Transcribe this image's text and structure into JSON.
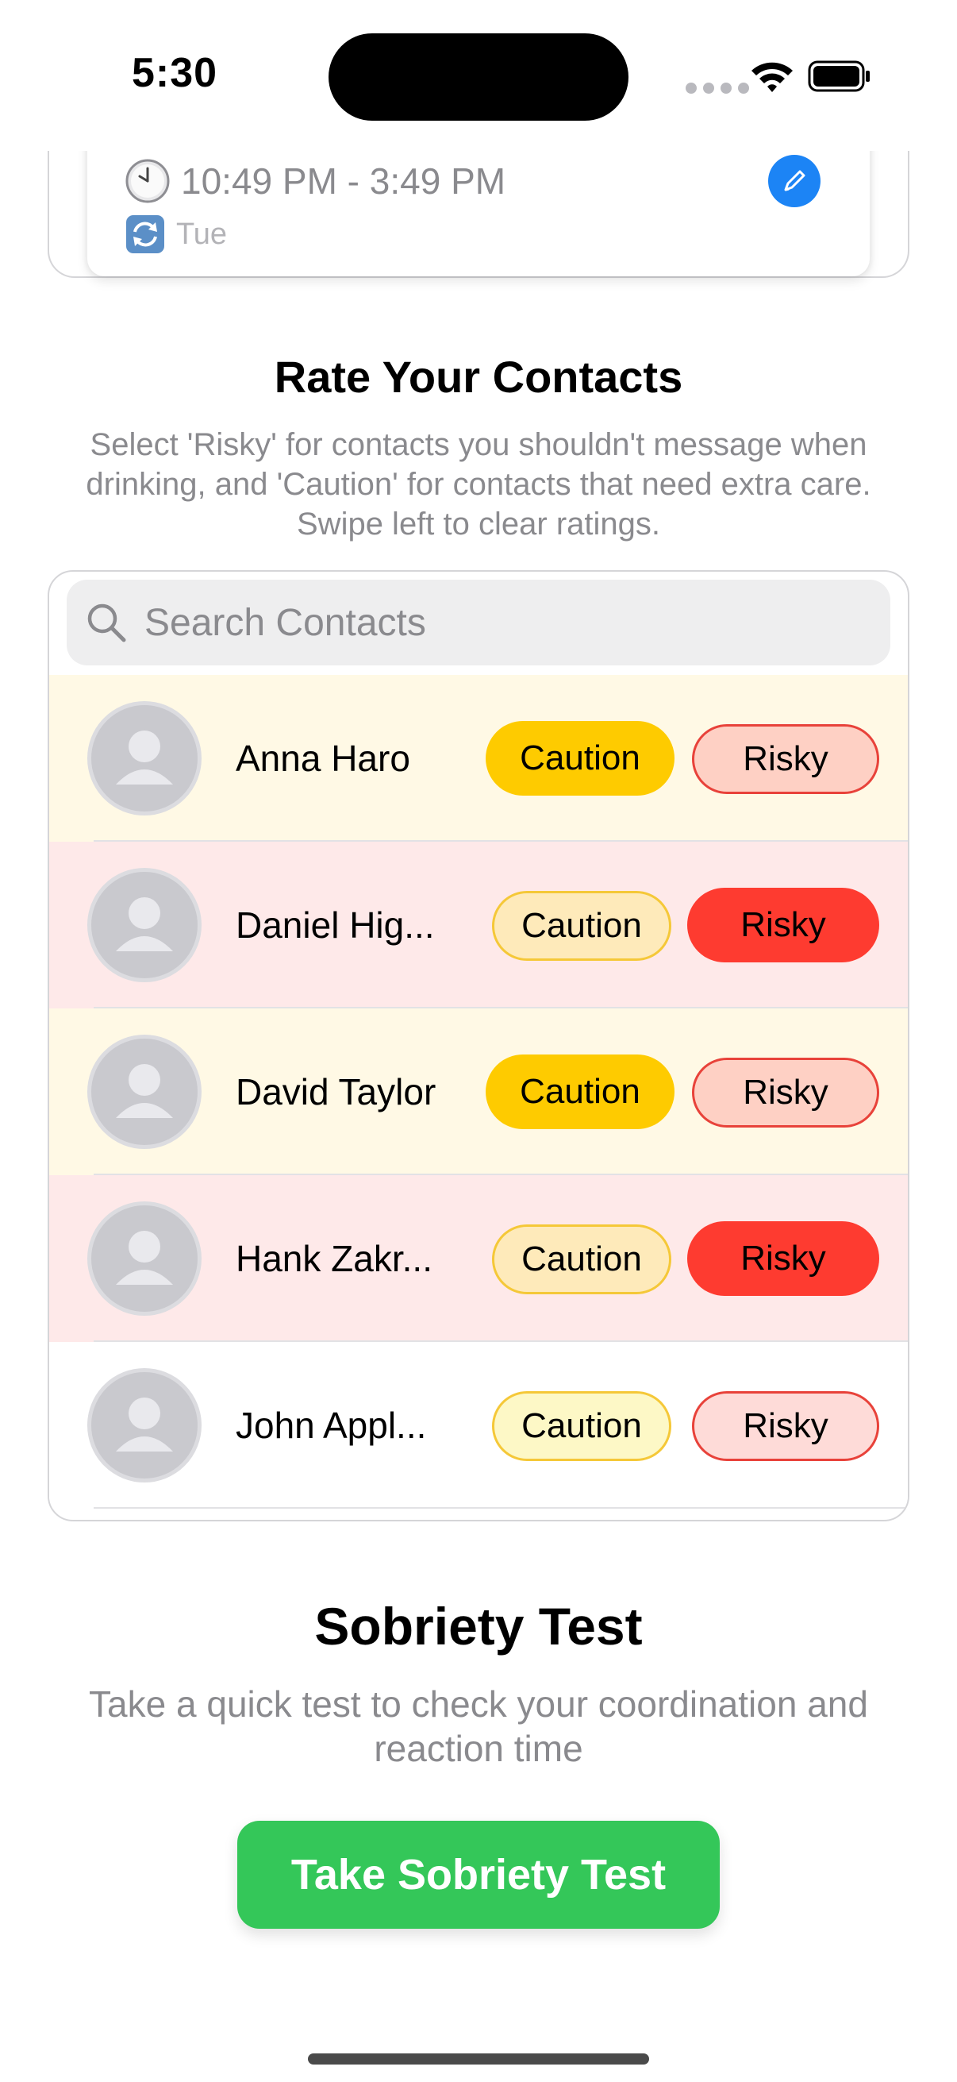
{
  "status_bar": {
    "time": "5:30"
  },
  "schedule": {
    "time_range": "10:49 PM - 3:49 PM",
    "days": "Tue",
    "clock_icon": "clock-emoji-icon",
    "repeat_icon": "repeat-emoji-icon",
    "edit_icon": "pencil-icon"
  },
  "contacts_section": {
    "title": "Rate Your Contacts",
    "description": "Select 'Risky' for contacts you shouldn't message when drinking, and 'Caution' for contacts that need extra care. Swipe left to clear ratings.",
    "search_placeholder": "Search Contacts",
    "caution_label": "Caution",
    "risky_label": "Risky",
    "contacts": [
      {
        "name": "Anna Haro",
        "rating": "caution"
      },
      {
        "name": "Daniel Hig...",
        "rating": "risky"
      },
      {
        "name": "David Taylor",
        "rating": "caution"
      },
      {
        "name": "Hank Zakr...",
        "rating": "risky"
      },
      {
        "name": "John Appl...",
        "rating": "none"
      }
    ]
  },
  "sobriety_section": {
    "title": "Sobriety Test",
    "description": "Take a quick test to check your coordination and reaction time",
    "button_label": "Take Sobriety Test"
  },
  "colors": {
    "accent_blue": "#1c84f5",
    "caution_active": "#fecb00",
    "risky_active": "#fe3b30",
    "sobriety_green": "#34c759"
  }
}
